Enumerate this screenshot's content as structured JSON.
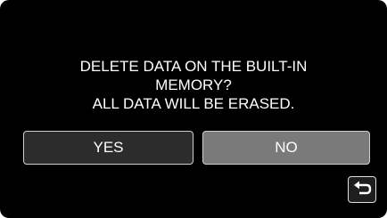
{
  "dialog": {
    "message_lines": [
      "DELETE DATA ON THE BUILT-IN",
      "MEMORY?",
      "ALL DATA WILL BE ERASED."
    ]
  },
  "buttons": {
    "yes_label": "YES",
    "no_label": "NO"
  },
  "back_button": {
    "icon": "return-arrow-icon"
  },
  "colors": {
    "background": "#000000",
    "yes_button": "#2c2c2c",
    "no_button": "#7a7a7a",
    "text": "#ffffff"
  }
}
